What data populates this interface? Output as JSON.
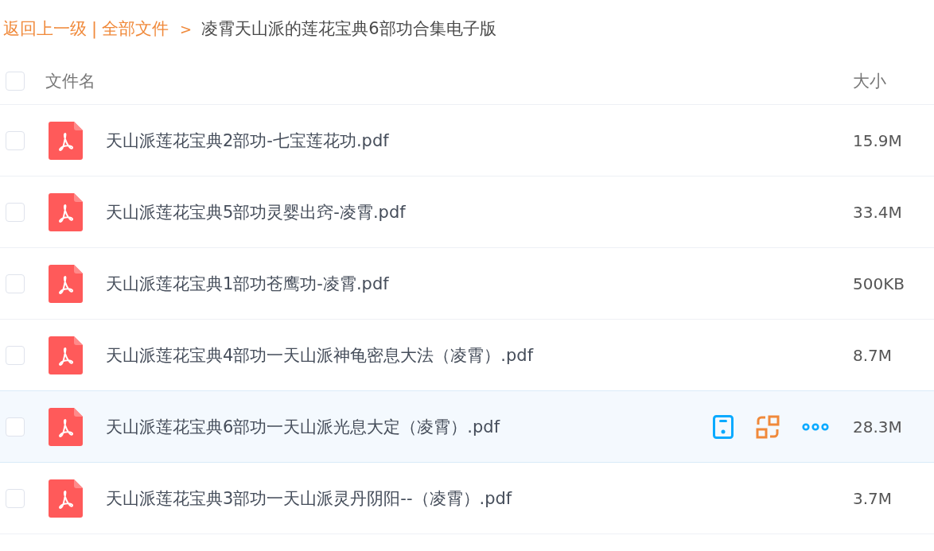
{
  "breadcrumb": {
    "back": "返回上一级",
    "separator": "|",
    "root": "全部文件",
    "arrow": ">",
    "current": "凌霄天山派的莲花宝典6部功合集电子版"
  },
  "header": {
    "checked": false,
    "name": "文件名",
    "size": "大小"
  },
  "rows": [
    {
      "name": "天山派莲花宝典2部功-七宝莲花功.pdf",
      "size": "15.9M",
      "checked": false,
      "hovered": false
    },
    {
      "name": "天山派莲花宝典5部功灵婴出窍-凌霄.pdf",
      "size": "33.4M",
      "checked": false,
      "hovered": false
    },
    {
      "name": "天山派莲花宝典1部功苍鹰功-凌霄.pdf",
      "size": "500KB",
      "checked": false,
      "hovered": false
    },
    {
      "name": "天山派莲花宝典4部功一天山派神龟密息大法（凌霄）.pdf",
      "size": "8.7M",
      "checked": false,
      "hovered": false
    },
    {
      "name": "天山派莲花宝典6部功一天山派光息大定（凌霄）.pdf",
      "size": "28.3M",
      "checked": false,
      "hovered": true
    },
    {
      "name": "天山派莲花宝典3部功一天山派灵丹阴阳--（凌霄）.pdf",
      "size": "3.7M",
      "checked": false,
      "hovered": false
    }
  ]
}
